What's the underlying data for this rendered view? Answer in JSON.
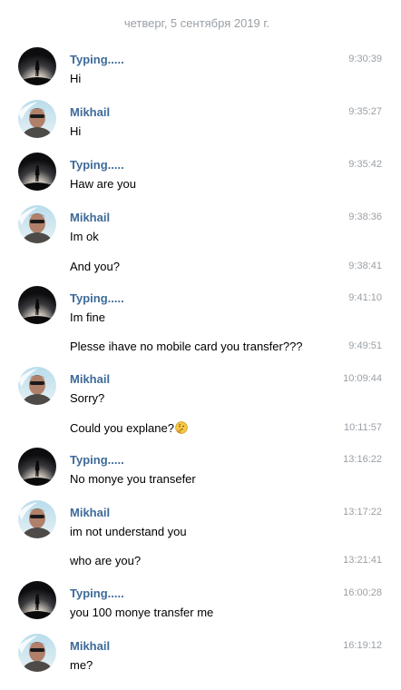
{
  "date_header": "четверг, 5 сентября 2019 г.",
  "users": {
    "typing": "Typing.....",
    "mikhail": "Mikhail"
  },
  "messages": [
    {
      "text": "Hi",
      "time": "9:30:39"
    },
    {
      "text": "Hi",
      "time": "9:35:27"
    },
    {
      "text": "Haw are you",
      "time": "9:35:42"
    },
    {
      "text": "Im ok",
      "time": "9:38:36"
    },
    {
      "text": "And you?",
      "time": "9:38:41"
    },
    {
      "text": "Im fine",
      "time": "9:41:10"
    },
    {
      "text": "Plesse ihave no mobile card you transfer???",
      "time": "9:49:51"
    },
    {
      "text": "Sorry?",
      "time": "10:09:44"
    },
    {
      "text": "Could you explane?",
      "time": "10:11:57",
      "emoji": "thinking-face"
    },
    {
      "text": "No monye you transefer",
      "time": "13:16:22"
    },
    {
      "text": "im not understand you",
      "time": "13:17:22"
    },
    {
      "text": "who are you?",
      "time": "13:21:41"
    },
    {
      "text": "you 100 monye transfer me",
      "time": "16:00:28"
    },
    {
      "text": "me?",
      "time": "16:19:12"
    }
  ]
}
